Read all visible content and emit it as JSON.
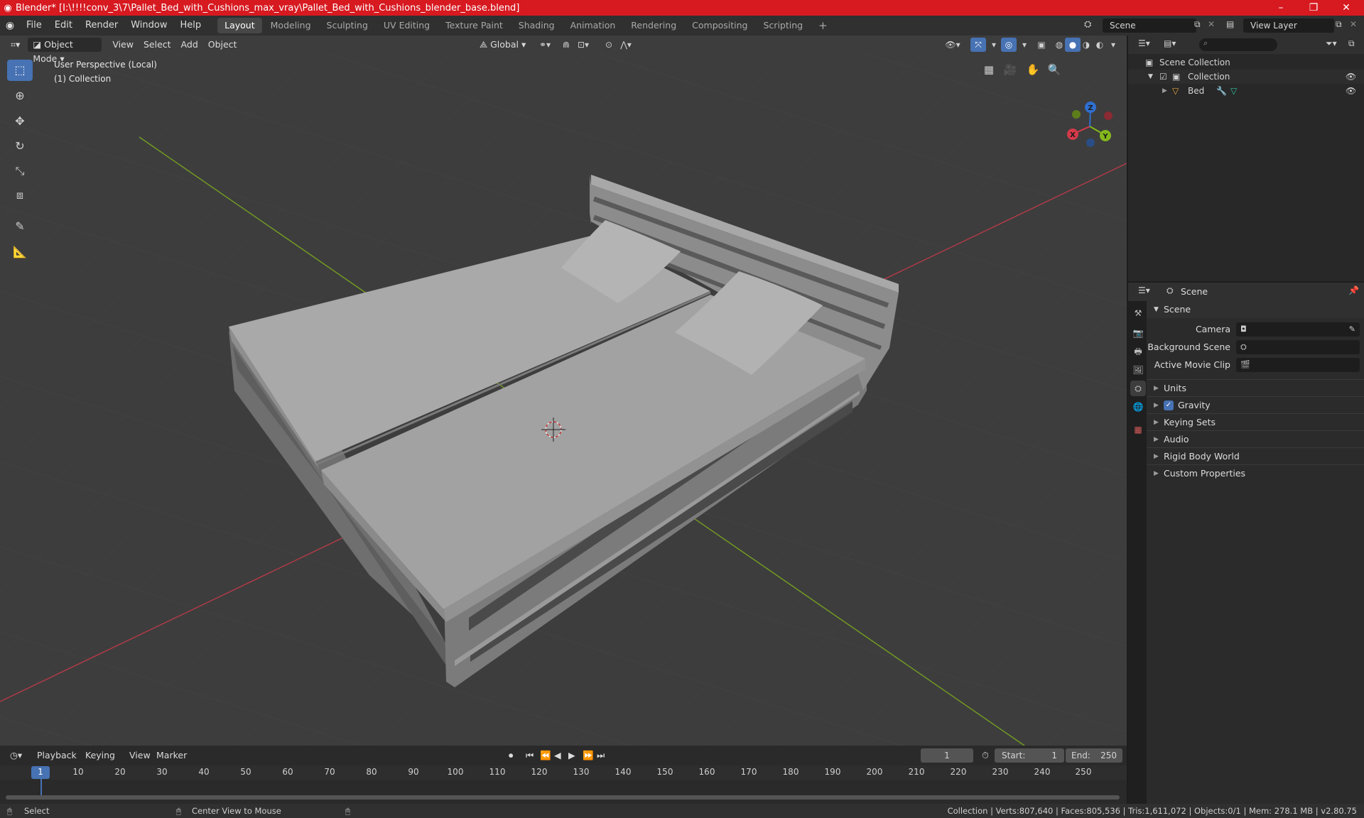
{
  "window": {
    "title": "Blender* [I:\\!!!!conv_3\\7\\Pallet_Bed_with_Cushions_max_vray\\Pallet_Bed_with_Cushions_blender_base.blend]",
    "minimize": "–",
    "maximize": "❐",
    "close": "✕"
  },
  "menubar": {
    "menus": [
      "File",
      "Edit",
      "Render",
      "Window",
      "Help"
    ],
    "workspaces": [
      "Layout",
      "Modeling",
      "Sculpting",
      "UV Editing",
      "Texture Paint",
      "Shading",
      "Animation",
      "Rendering",
      "Compositing",
      "Scripting"
    ],
    "active_workspace": "Layout",
    "add_workspace": "+",
    "scene_value": "Scene",
    "view_layer_value": "View Layer"
  },
  "viewport": {
    "mode": "Object Mode",
    "menus": [
      "View",
      "Select",
      "Add",
      "Object"
    ],
    "transform_orientation": "Global",
    "perspective_label": "User Perspective (Local)",
    "collection_label": "(1) Collection",
    "gizmo_axes": [
      "X",
      "Y",
      "Z"
    ],
    "colors": {
      "background": "#3d3d3d",
      "accent": "#4772b3",
      "x_axis": "#d43a4a",
      "y_axis": "#84b81c",
      "z_axis": "#2f6fd0"
    }
  },
  "outliner": {
    "root": "Scene Collection",
    "collection": "Collection",
    "object": "Bed"
  },
  "properties": {
    "context": "Scene",
    "panel_title": "Scene",
    "fields": [
      {
        "label": "Camera"
      },
      {
        "label": "Background Scene"
      },
      {
        "label": "Active Movie Clip"
      }
    ],
    "sections": [
      "Units",
      "Gravity",
      "Keying Sets",
      "Audio",
      "Rigid Body World",
      "Custom Properties"
    ],
    "gravity_checked": true
  },
  "timeline": {
    "menus": [
      "Playback",
      "Keying",
      "View",
      "Marker"
    ],
    "current_frame": "1",
    "start_label": "Start:",
    "start_value": "1",
    "end_label": "End:",
    "end_value": "250",
    "frame_ticks": [
      "1",
      "10",
      "20",
      "30",
      "40",
      "50",
      "60",
      "70",
      "80",
      "90",
      "100",
      "110",
      "120",
      "130",
      "140",
      "150",
      "160",
      "170",
      "180",
      "190",
      "200",
      "210",
      "220",
      "230",
      "240",
      "250"
    ]
  },
  "statusbar": {
    "select": "Select",
    "center_view": "Center View to Mouse",
    "stats": "Collection | Verts:807,640 | Faces:805,536 | Tris:1,611,072 | Objects:0/1 | Mem: 278.1 MB | v2.80.75"
  }
}
